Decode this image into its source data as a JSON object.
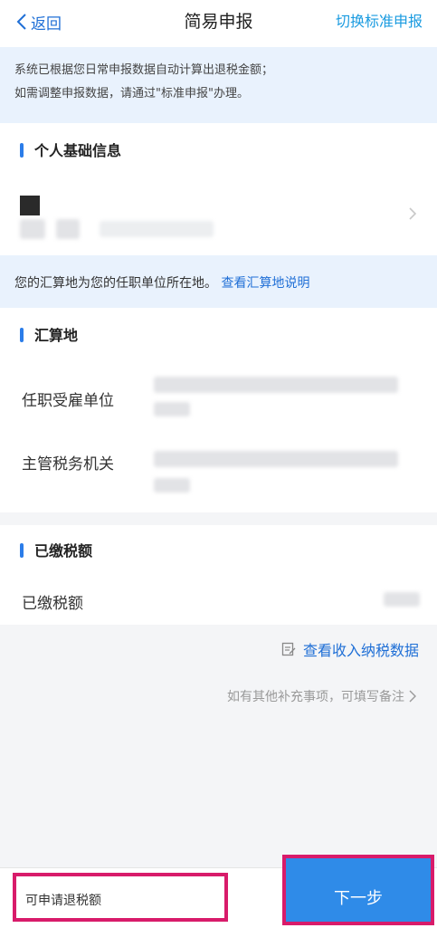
{
  "nav": {
    "back_label": "返回",
    "title": "简易申报",
    "switch_label": "切换标准申报"
  },
  "notice": {
    "line1": "系统已根据您日常申报数据自动计算出退税金额；",
    "line2": "如需调整申报数据，请通过\"标准申报\"办理。"
  },
  "personal": {
    "section_title": "个人基础信息"
  },
  "filing_location": {
    "info_text": "您的汇算地为您的任职单位所在地。",
    "info_link": "查看汇算地说明",
    "section_title": "汇算地",
    "employer_label": "任职受雇单位",
    "tax_authority_label": "主管税务机关"
  },
  "tax_paid": {
    "section_title": "已缴税额",
    "row_label": "已缴税额",
    "view_data_link": "查看收入纳税数据"
  },
  "remarks": {
    "hint": "如有其他补充事项，可填写备注"
  },
  "footer": {
    "refund_label": "可申请退税额",
    "next_button": "下一步"
  },
  "colors": {
    "accent": "#1f6fd6",
    "highlight_border": "#d81b6a",
    "button_bg": "#2f8be8"
  }
}
